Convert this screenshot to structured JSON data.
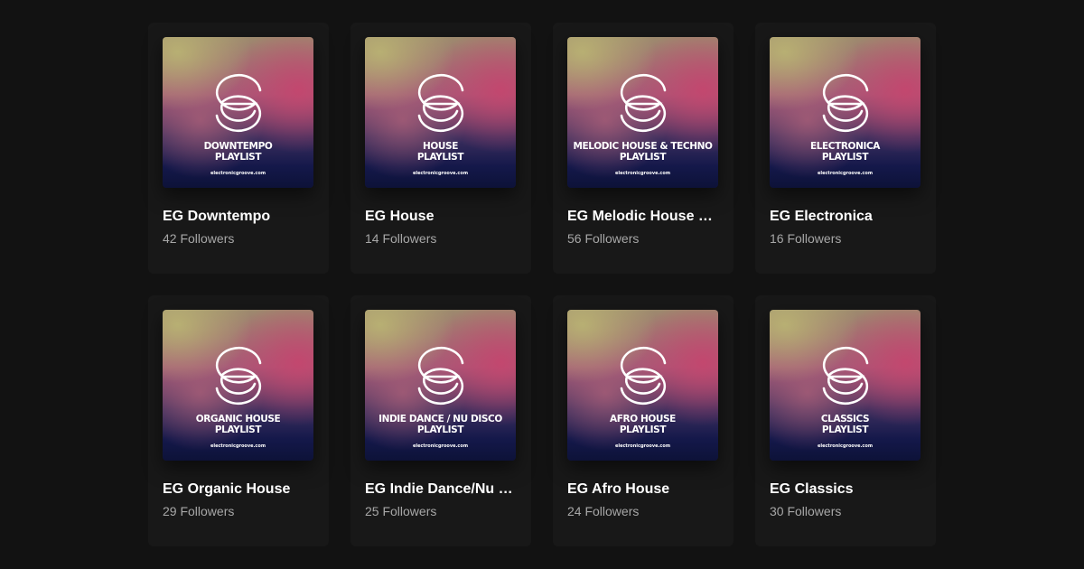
{
  "colors": {
    "background": "#121212",
    "card": "#181818",
    "title": "#ffffff",
    "subtitle": "#a7a7a7"
  },
  "cover": {
    "logo_icon": "electronic-groove-logo-icon",
    "url": "electronicgroove.com"
  },
  "playlists": [
    {
      "cover_line1": "DOWNTEMPO",
      "cover_line2": "PLAYLIST",
      "title": "EG Downtempo",
      "followers": "42 Followers"
    },
    {
      "cover_line1": "HOUSE",
      "cover_line2": "PLAYLIST",
      "title": "EG House",
      "followers": "14 Followers"
    },
    {
      "cover_line1": "MELODIC HOUSE & TECHNO",
      "cover_line2": "PLAYLIST",
      "title": "EG Melodic House & Techno",
      "followers": "56 Followers"
    },
    {
      "cover_line1": "ELECTRONICA",
      "cover_line2": "PLAYLIST",
      "title": "EG Electronica",
      "followers": "16 Followers"
    },
    {
      "cover_line1": "ORGANIC HOUSE",
      "cover_line2": "PLAYLIST",
      "title": "EG Organic House",
      "followers": "29 Followers"
    },
    {
      "cover_line1": "INDIE DANCE / NU DISCO",
      "cover_line2": "PLAYLIST",
      "title": "EG Indie Dance/Nu Disco",
      "followers": "25 Followers"
    },
    {
      "cover_line1": "AFRO HOUSE",
      "cover_line2": "PLAYLIST",
      "title": "EG Afro House",
      "followers": "24 Followers"
    },
    {
      "cover_line1": "CLASSICS",
      "cover_line2": "PLAYLIST",
      "title": "EG Classics",
      "followers": "30 Followers"
    }
  ]
}
